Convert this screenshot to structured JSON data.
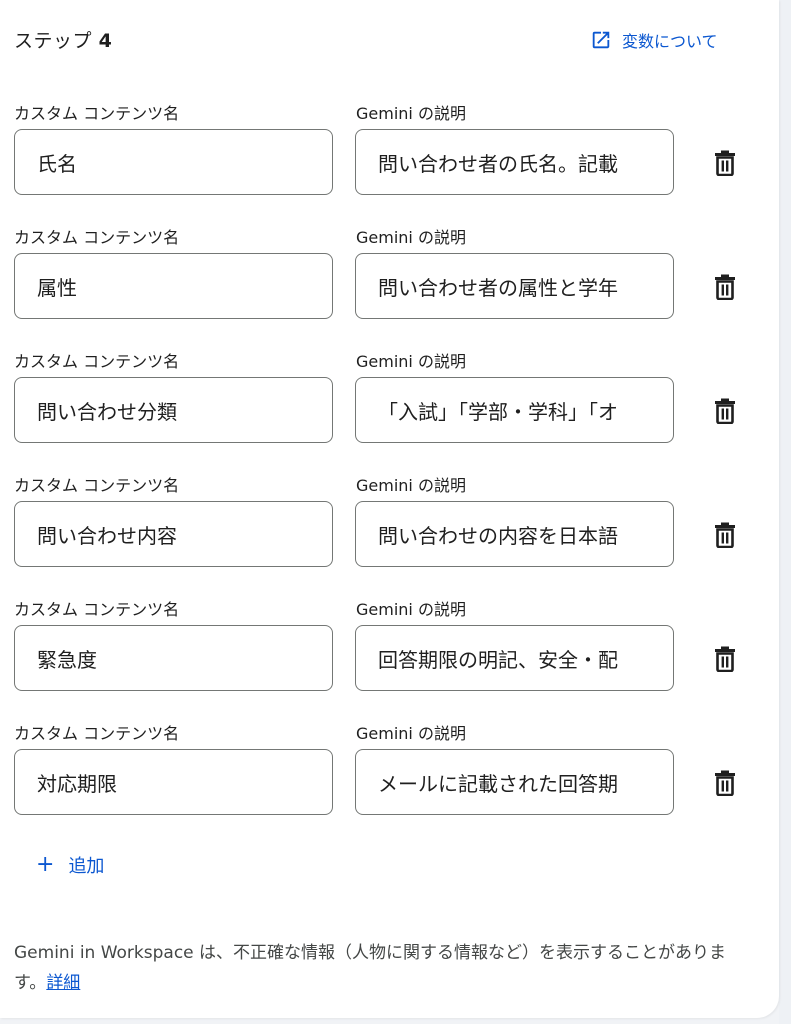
{
  "step": {
    "label": "ステップ",
    "number": "4"
  },
  "vars_link": {
    "label": "変数について",
    "icon": "open-in-new-icon"
  },
  "labels": {
    "name": "カスタム コンテンツ名",
    "desc": "Gemini の説明"
  },
  "rows": [
    {
      "name": "氏名",
      "desc": "問い合わせ者の氏名。記載"
    },
    {
      "name": "属性",
      "desc": "問い合わせ者の属性と学年"
    },
    {
      "name": "問い合わせ分類",
      "desc": "「入試」「学部・学科」「オ"
    },
    {
      "name": "問い合わせ内容",
      "desc": "問い合わせの内容を日本語"
    },
    {
      "name": "緊急度",
      "desc": "回答期限の明記、安全・配"
    },
    {
      "name": "対応期限",
      "desc": "メールに記載された回答期"
    }
  ],
  "add_button": {
    "label": "追加"
  },
  "disclaimer": {
    "text": "Gemini in Workspace は、不正確な情報（人物に関する情報など）を表示することがあります。",
    "link": "詳細"
  },
  "colors": {
    "accent": "#0b57d0",
    "border": "#747775",
    "text": "#1f1f1f"
  }
}
